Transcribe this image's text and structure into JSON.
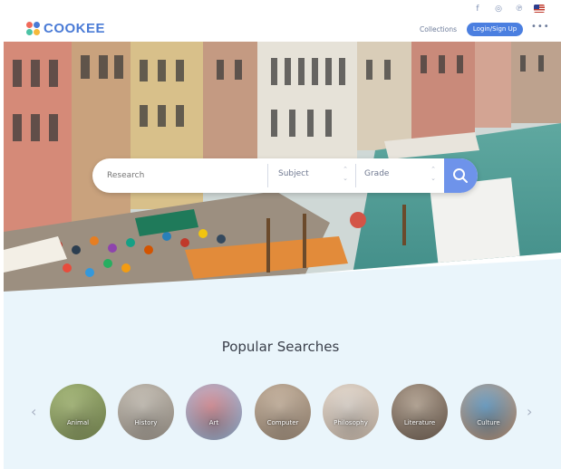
{
  "social": {
    "icons": [
      "f",
      "◎",
      "℗"
    ],
    "icon_names": [
      "facebook-icon",
      "instagram-icon",
      "pinterest-icon"
    ]
  },
  "header": {
    "logo_text": "COOKEE",
    "collections": "Collections",
    "login": "Login/Sign Up",
    "more": "•••"
  },
  "search": {
    "placeholder": "Research",
    "subject": "Subject",
    "grade": "Grade"
  },
  "popular": {
    "title": "Popular Searches",
    "prev": "‹",
    "next": "›",
    "categories": [
      "Animal",
      "History",
      "Art",
      "Computer",
      "Philosophy",
      "Literature",
      "Culture"
    ]
  },
  "colors": {
    "brand": "#4a7bd6",
    "accent": "#6e93ea",
    "popular_bg": "#eaf5fb"
  }
}
